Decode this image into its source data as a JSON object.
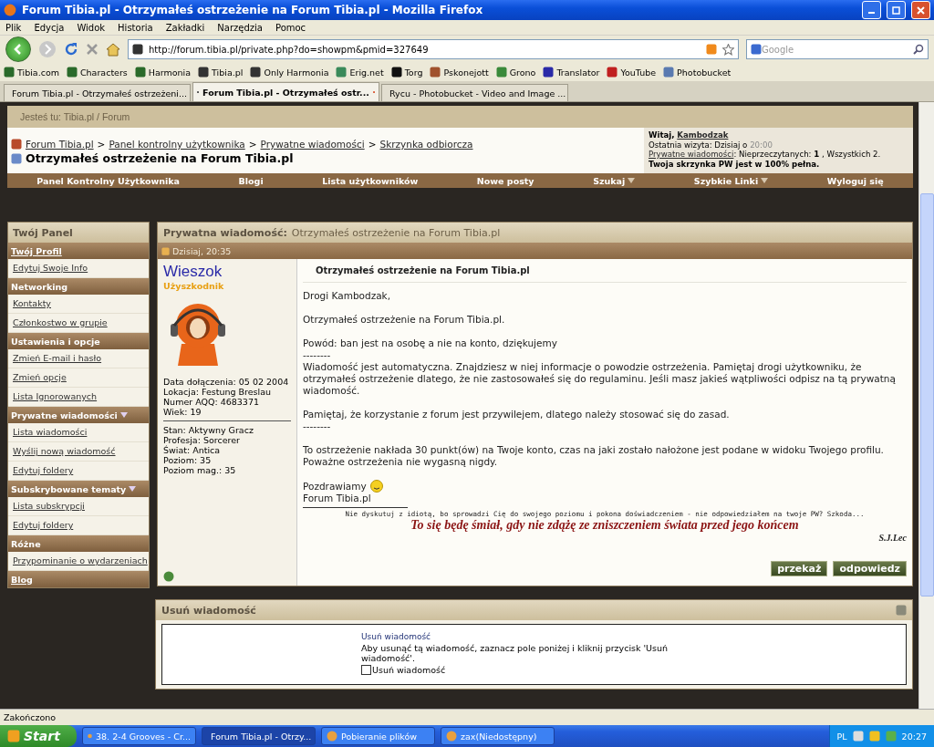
{
  "window": {
    "title": "Forum Tibia.pl - Otrzymałeś ostrzeżenie na Forum Tibia.pl - Mozilla Firefox"
  },
  "menu": [
    "Plik",
    "Edycja",
    "Widok",
    "Historia",
    "Zakładki",
    "Narzędzia",
    "Pomoc"
  ],
  "address": {
    "value": "http://forum.tibia.pl/private.php?do=showpm&pmid=327649"
  },
  "search": {
    "placeholder": "Google"
  },
  "bookmarks": [
    "Tibia.com",
    "Characters",
    "Harmonia",
    "Tibia.pl",
    "Only Harmonia",
    "Erig.net",
    "Torg",
    "Pskonejott",
    "Grono",
    "Translator",
    "YouTube",
    "Photobucket"
  ],
  "tabs": [
    {
      "label": "Forum Tibia.pl - Otrzymałeś ostrzeżeni...",
      "selected": false
    },
    {
      "label": "Forum Tibia.pl - Otrzymałeś ostr...",
      "selected": true
    },
    {
      "label": "Rycu - Photobucket - Video and Image ...",
      "selected": false
    }
  ],
  "location_bar": "Jesteś tu: Tibia.pl / Forum",
  "breadcrumb": {
    "items": [
      "Forum Tibia.pl",
      "Panel kontrolny użytkownika",
      "Prywatne wiadomości",
      "Skrzynka odbiorcza"
    ],
    "separator": ">",
    "current": "Otrzymałeś ostrzeżenie na Forum Tibia.pl"
  },
  "user_box": {
    "greeting": "Witaj,",
    "username": "Kambodzak",
    "last_visit": "Ostatnia wizyta: Dzisiaj o",
    "last_visit_time": "20:00",
    "pm_link": "Prywatne wiadomości",
    "pm_text": ": Nieprzeczytanych: **1** , Wszystkich 2.",
    "notice": "Twoja skrzynka PW jest w 100% pełna."
  },
  "navbar": [
    {
      "label": "Panel Kontrolny Użytkownika",
      "dropdown": false
    },
    {
      "label": "Blogi",
      "dropdown": false
    },
    {
      "label": "Lista użytkowników",
      "dropdown": false
    },
    {
      "label": "Nowe posty",
      "dropdown": false
    },
    {
      "label": "Szukaj",
      "dropdown": true
    },
    {
      "label": "Szybkie Linki",
      "dropdown": true
    },
    {
      "label": "Wyloguj się",
      "dropdown": false
    }
  ],
  "sidebar": {
    "title": "Twój Panel",
    "items": [
      {
        "kind": "header-link",
        "label": "Twój Profil",
        "dropdown": false
      },
      {
        "kind": "link",
        "label": "Edytuj Swoje Info"
      },
      {
        "kind": "header",
        "label": "Networking",
        "dropdown": false
      },
      {
        "kind": "link",
        "label": "Kontakty"
      },
      {
        "kind": "link",
        "label": "Członkostwo w grupie"
      },
      {
        "kind": "header",
        "label": "Ustawienia i opcje",
        "dropdown": false
      },
      {
        "kind": "link",
        "label": "Zmień E-mail i hasło"
      },
      {
        "kind": "link",
        "label": "Zmień opcje"
      },
      {
        "kind": "link",
        "label": "Lista Ignorowanych"
      },
      {
        "kind": "header",
        "label": "Prywatne wiadomości",
        "dropdown": true
      },
      {
        "kind": "link",
        "label": "Lista wiadomości"
      },
      {
        "kind": "link",
        "label": "Wyślij nową wiadomość"
      },
      {
        "kind": "link",
        "label": "Edytuj foldery"
      },
      {
        "kind": "header",
        "label": "Subskrybowane tematy",
        "dropdown": true
      },
      {
        "kind": "link",
        "label": "Lista subskrypcji"
      },
      {
        "kind": "link",
        "label": "Edytuj foldery"
      },
      {
        "kind": "header",
        "label": "Różne",
        "dropdown": false
      },
      {
        "kind": "link",
        "label": "Przypominanie o wydarzeniach"
      },
      {
        "kind": "header-link",
        "label": "Blog",
        "dropdown": false
      }
    ]
  },
  "message": {
    "title_label": "Prywatna wiadomość:",
    "title": "Otrzymałeś ostrzeżenie na Forum Tibia.pl",
    "date": "Dzisiaj, 20:35",
    "author": {
      "name": "Wieszok",
      "rank": "Użyszkodnik",
      "info": [
        "Data dołączenia: 05 02 2004",
        "Lokacja: Festung Breslau",
        "Numer AQQ: 4683371",
        "Wiek: 19"
      ],
      "stats": [
        "Stan: Aktywny Gracz",
        "Profesja: Sorcerer",
        "Świat: Antica",
        "Poziom: 35",
        "Poziom mag.: 35"
      ]
    },
    "subject": "Otrzymałeś ostrzeżenie na Forum Tibia.pl",
    "body": [
      [
        "Drogi Kambodzak,"
      ],
      [
        "Otrzymałeś ostrzeżenie na Forum Tibia.pl."
      ],
      [
        "Powód: ban jest na osobę a nie na konto, dziękujemy",
        "--------",
        "Wiadomość jest automatyczna. Znajdziesz w niej informacje o powodzie ostrzeżenia. Pamiętaj drogi użytkowniku, że otrzymałeś ostrzeżenie dlatego, że nie zastosowałeś się do regulaminu. Jeśli masz jakieś wątpliwości odpisz na tą prywatną wiadomość."
      ],
      [
        "Pamiętaj, że korzystanie z forum jest przywilejem, dlatego należy stosować się do zasad.",
        "--------"
      ],
      [
        "To ostrzeżenie nakłada 30 punkt(ów) na Twoje konto, czas na jaki zostało nałożone jest podane w widoku Twojego profilu. Poważne ostrzeżenia nie wygasną nigdy."
      ]
    ],
    "closing": [
      "Pozdrawiamy",
      "Forum Tibia.pl"
    ],
    "signature": {
      "quote": "Nie dyskutuj z idiotą, bo sprowadzi Cię do swojego poziomu i pokona doświadczeniem - nie odpowiedziałem na twoje PW? Szkoda...",
      "motto": "To się będę śmiał, gdy nie zdążę ze zniszczeniem świata przed jego końcem",
      "author": "S.J.Lec"
    },
    "buttons": [
      "przekaż",
      "odpowiedz"
    ]
  },
  "delete_panel": {
    "title": "Usuń wiadomość",
    "label": "Usuń wiadomość",
    "description": "Aby usunąć tą wiadomość, zaznacz pole poniżej i kliknij przycisk 'Usuń wiadomość'.",
    "checkbox": {
      "label": "Usuń wiadomość",
      "checked": false
    }
  },
  "status_bar": "Zakończono",
  "taskbar": {
    "start": "Start",
    "items": [
      {
        "label": "38. 2-4 Grooves - Cr...",
        "selected": false
      },
      {
        "label": "Forum Tibia.pl - Otrzy...",
        "selected": true
      },
      {
        "label": "Pobieranie plików",
        "selected": false
      },
      {
        "label": "zax(Niedostępny)",
        "selected": false
      }
    ],
    "language": "PL",
    "time": "20:27"
  }
}
